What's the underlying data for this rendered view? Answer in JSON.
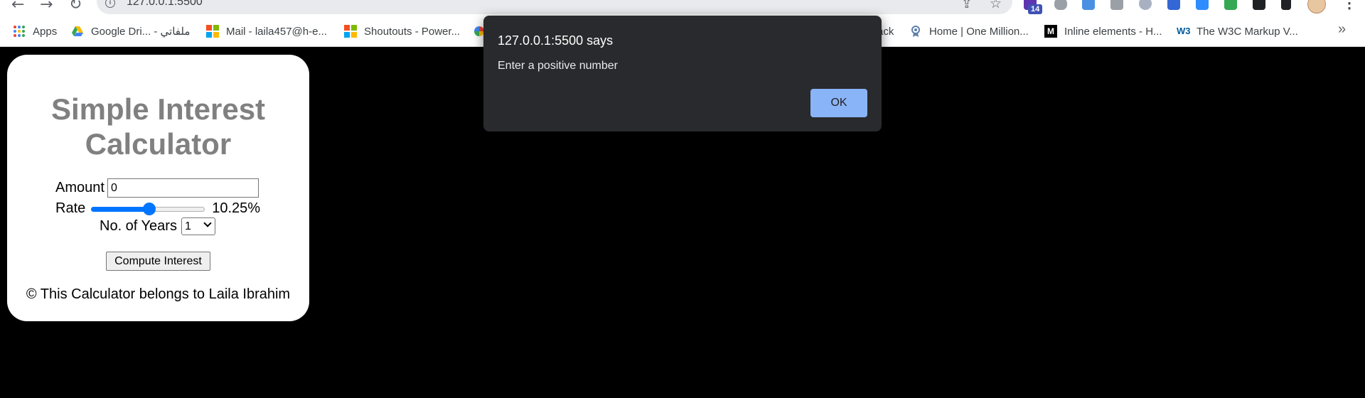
{
  "browser": {
    "url": "127.0.0.1:5500",
    "extension_badge": "14",
    "bookmarks": [
      {
        "label": "Apps"
      },
      {
        "label": "Google Dri... - ملفاتي"
      },
      {
        "label": "Mail - laila457@h-e..."
      },
      {
        "label": "Shoutouts - Power..."
      },
      {
        "label": "ack"
      },
      {
        "label": "Home | One Million..."
      },
      {
        "label": "Inline elements - H..."
      },
      {
        "label": "The W3C Markup V..."
      }
    ],
    "overflow_label": "»"
  },
  "calculator": {
    "title": "Simple Interest Calculator",
    "amount_label": "Amount",
    "amount_value": "0",
    "rate_label": "Rate",
    "rate_value": 10.25,
    "rate_display": "10.25%",
    "rate_fraction": 0.51,
    "years_label": "No. of Years",
    "years_value": "1",
    "compute_button": "Compute Interest",
    "footer": "© This Calculator belongs to Laila Ibrahim"
  },
  "alert": {
    "title": "127.0.0.1:5500 says",
    "message": "Enter a positive number",
    "ok_button": "OK"
  },
  "colors": {
    "page_background": "#000000",
    "title_color": "#808080",
    "accent": "#0075ff",
    "dialog_background": "#292a2d",
    "dialog_button": "#8ab4f8"
  }
}
